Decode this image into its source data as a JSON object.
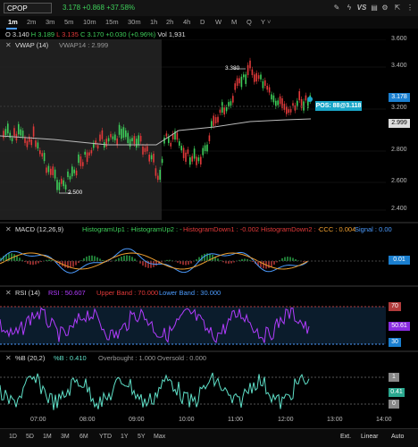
{
  "toolbar": {
    "symbol": "CPOP",
    "last": "3.178",
    "change": "+0.868",
    "change_pct": "+37.58%",
    "vs_label": "VS"
  },
  "timeframes": [
    "1m",
    "2m",
    "3m",
    "5m",
    "10m",
    "15m",
    "30m",
    "1h",
    "2h",
    "4h",
    "D",
    "W",
    "M",
    "Q",
    "Y"
  ],
  "active_timeframe": "1m",
  "ohlc": {
    "o": "O 3.140",
    "h": "H 3.189",
    "l": "L 3.135",
    "c": "C 3.170",
    "chg": "+0.030 (+0.96%)",
    "vol": "Vol 1,931"
  },
  "price_pane": {
    "study": "VWAP (14)",
    "study_value": "VWAP14 : 2.999",
    "y_ticks": [
      "3.600",
      "3.400",
      "3.200",
      "3.000",
      "2.800",
      "2.600",
      "2.400"
    ],
    "high_marker": "3.380",
    "low_marker": "2.500",
    "position_label": "POS: 88@3.118",
    "last_tag": "3.178",
    "vwap_tag": "2.999"
  },
  "macd_pane": {
    "title": "MACD (12,26,9)",
    "hist_up1": "HistogramUp1 : -",
    "hist_up2": "HistogramUp2 : -",
    "hist_down1": "HistogramDown1 : -0.002",
    "hist_down2": "HistogramDown2 : -",
    "ccc": "CCC : 0.004",
    "signal": "Signal : 0.00",
    "tag": "0.01"
  },
  "rsi_pane": {
    "title": "RSI (14)",
    "rsi_value": "RSI : 50.607",
    "upper": "Upper Band : 70.000",
    "lower": "Lower Band : 30.000",
    "tag_upper": "70",
    "tag_value": "50.61",
    "tag_lower": "30"
  },
  "pctb_pane": {
    "title": "%B (20,2)",
    "value": "%B : 0.410",
    "overbought": "Overbought : 1.000",
    "oversold": "Oversold : 0.000",
    "tag_upper": "1",
    "tag_value": "0.41",
    "tag_lower": "0"
  },
  "time_axis": [
    "07:00",
    "08:00",
    "09:00",
    "10:00",
    "11:00",
    "12:00",
    "13:00",
    "14:00"
  ],
  "ranges": [
    "1D",
    "5D",
    "1M",
    "3M",
    "6M",
    "YTD",
    "1Y",
    "5Y",
    "Max"
  ],
  "right_controls": [
    "Ext.",
    "Linear",
    "Auto"
  ],
  "colors": {
    "up": "#3ecf5a",
    "down": "#e23a3a",
    "accent": "#4c9cff",
    "rsi": "#b23cff",
    "pctb": "#5fe0c8",
    "tag": "#1a7fd0",
    "pos": "#1aa7c9"
  }
}
